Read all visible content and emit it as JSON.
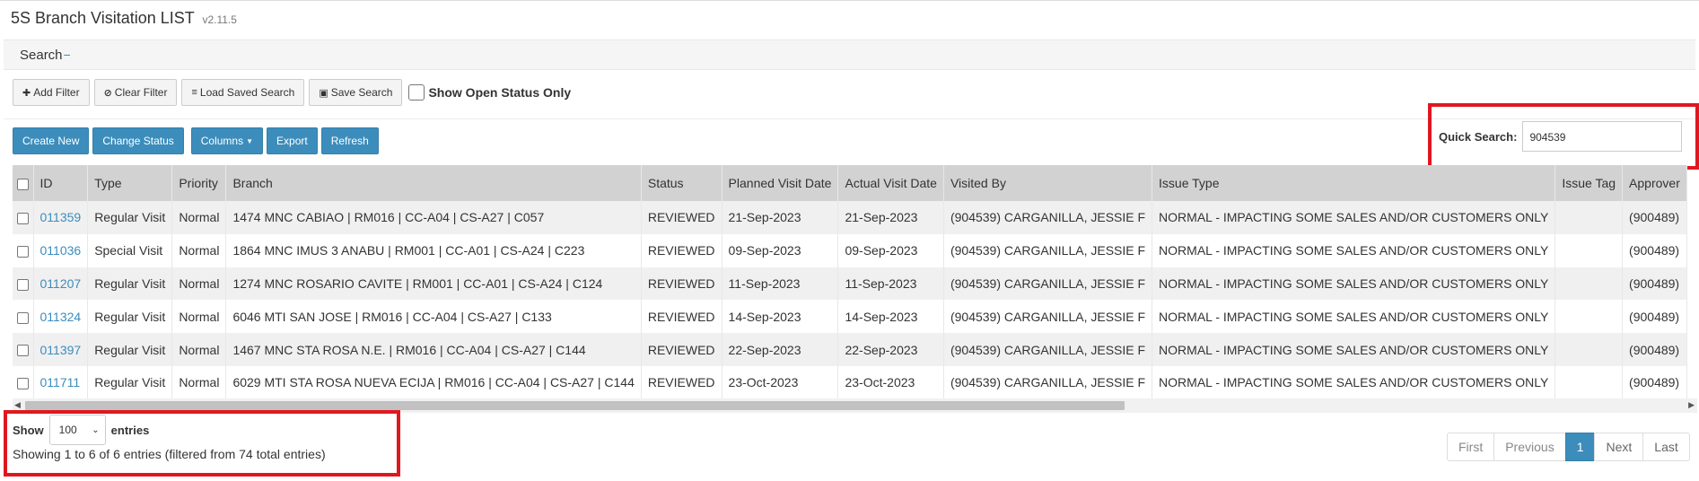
{
  "page": {
    "title": "5S Branch Visitation LIST",
    "version": "v2.11.5"
  },
  "search_panel": {
    "label": "Search",
    "toggle": "−"
  },
  "filter_bar": {
    "add_filter": "Add Filter",
    "clear_filter": "Clear Filter",
    "load_saved_search": "Load Saved Search",
    "save_search": "Save Search",
    "show_open_status_only": "Show Open Status Only"
  },
  "actions": {
    "create_new": "Create New",
    "change_status": "Change Status",
    "columns": "Columns",
    "export": "Export",
    "refresh": "Refresh"
  },
  "quick_search": {
    "label": "Quick Search:",
    "value": "904539"
  },
  "table": {
    "columns": [
      "ID",
      "Type",
      "Priority",
      "Branch",
      "Status",
      "Planned Visit Date",
      "Actual Visit Date",
      "Visited By",
      "Issue Type",
      "Issue Tag",
      "Approver"
    ],
    "rows": [
      [
        "011359",
        "Regular Visit",
        "Normal",
        "1474 MNC CABIAO | RM016 | CC-A04 | CS-A27 | C057",
        "REVIEWED",
        "21-Sep-2023",
        "21-Sep-2023",
        "(904539) CARGANILLA, JESSIE F",
        "NORMAL - IMPACTING SOME SALES AND/OR CUSTOMERS ONLY",
        "",
        "(900489)"
      ],
      [
        "011036",
        "Special Visit",
        "Normal",
        "1864 MNC IMUS 3 ANABU | RM001 | CC-A01 | CS-A24 | C223",
        "REVIEWED",
        "09-Sep-2023",
        "09-Sep-2023",
        "(904539) CARGANILLA, JESSIE F",
        "NORMAL - IMPACTING SOME SALES AND/OR CUSTOMERS ONLY",
        "",
        "(900489)"
      ],
      [
        "011207",
        "Regular Visit",
        "Normal",
        "1274 MNC ROSARIO CAVITE | RM001 | CC-A01 | CS-A24 | C124",
        "REVIEWED",
        "11-Sep-2023",
        "11-Sep-2023",
        "(904539) CARGANILLA, JESSIE F",
        "NORMAL - IMPACTING SOME SALES AND/OR CUSTOMERS ONLY",
        "",
        "(900489)"
      ],
      [
        "011324",
        "Regular Visit",
        "Normal",
        "6046 MTI SAN JOSE | RM016 | CC-A04 | CS-A27 | C133",
        "REVIEWED",
        "14-Sep-2023",
        "14-Sep-2023",
        "(904539) CARGANILLA, JESSIE F",
        "NORMAL - IMPACTING SOME SALES AND/OR CUSTOMERS ONLY",
        "",
        "(900489)"
      ],
      [
        "011397",
        "Regular Visit",
        "Normal",
        "1467 MNC STA ROSA N.E. | RM016 | CC-A04 | CS-A27 | C144",
        "REVIEWED",
        "22-Sep-2023",
        "22-Sep-2023",
        "(904539) CARGANILLA, JESSIE F",
        "NORMAL - IMPACTING SOME SALES AND/OR CUSTOMERS ONLY",
        "",
        "(900489)"
      ],
      [
        "011711",
        "Regular Visit",
        "Normal",
        "6029 MTI STA ROSA NUEVA ECIJA | RM016 | CC-A04 | CS-A27 | C144",
        "REVIEWED",
        "23-Oct-2023",
        "23-Oct-2023",
        "(904539) CARGANILLA, JESSIE F",
        "NORMAL - IMPACTING SOME SALES AND/OR CUSTOMERS ONLY",
        "",
        "(900489)"
      ]
    ]
  },
  "length_menu": {
    "show": "Show",
    "value": "100",
    "entries": "entries"
  },
  "info": "Showing 1 to 6 of 6 entries (filtered from 74 total entries)",
  "pagination": {
    "first": "First",
    "previous": "Previous",
    "current": "1",
    "next": "Next",
    "last": "Last"
  },
  "icons": {
    "add_filter": "plus-icon",
    "clear_filter": "ban-icon",
    "load_saved_search": "database-icon",
    "save_search": "floppy-disk-icon"
  },
  "colors": {
    "primary": "#3c8dbc",
    "highlight": "#e0171f"
  }
}
